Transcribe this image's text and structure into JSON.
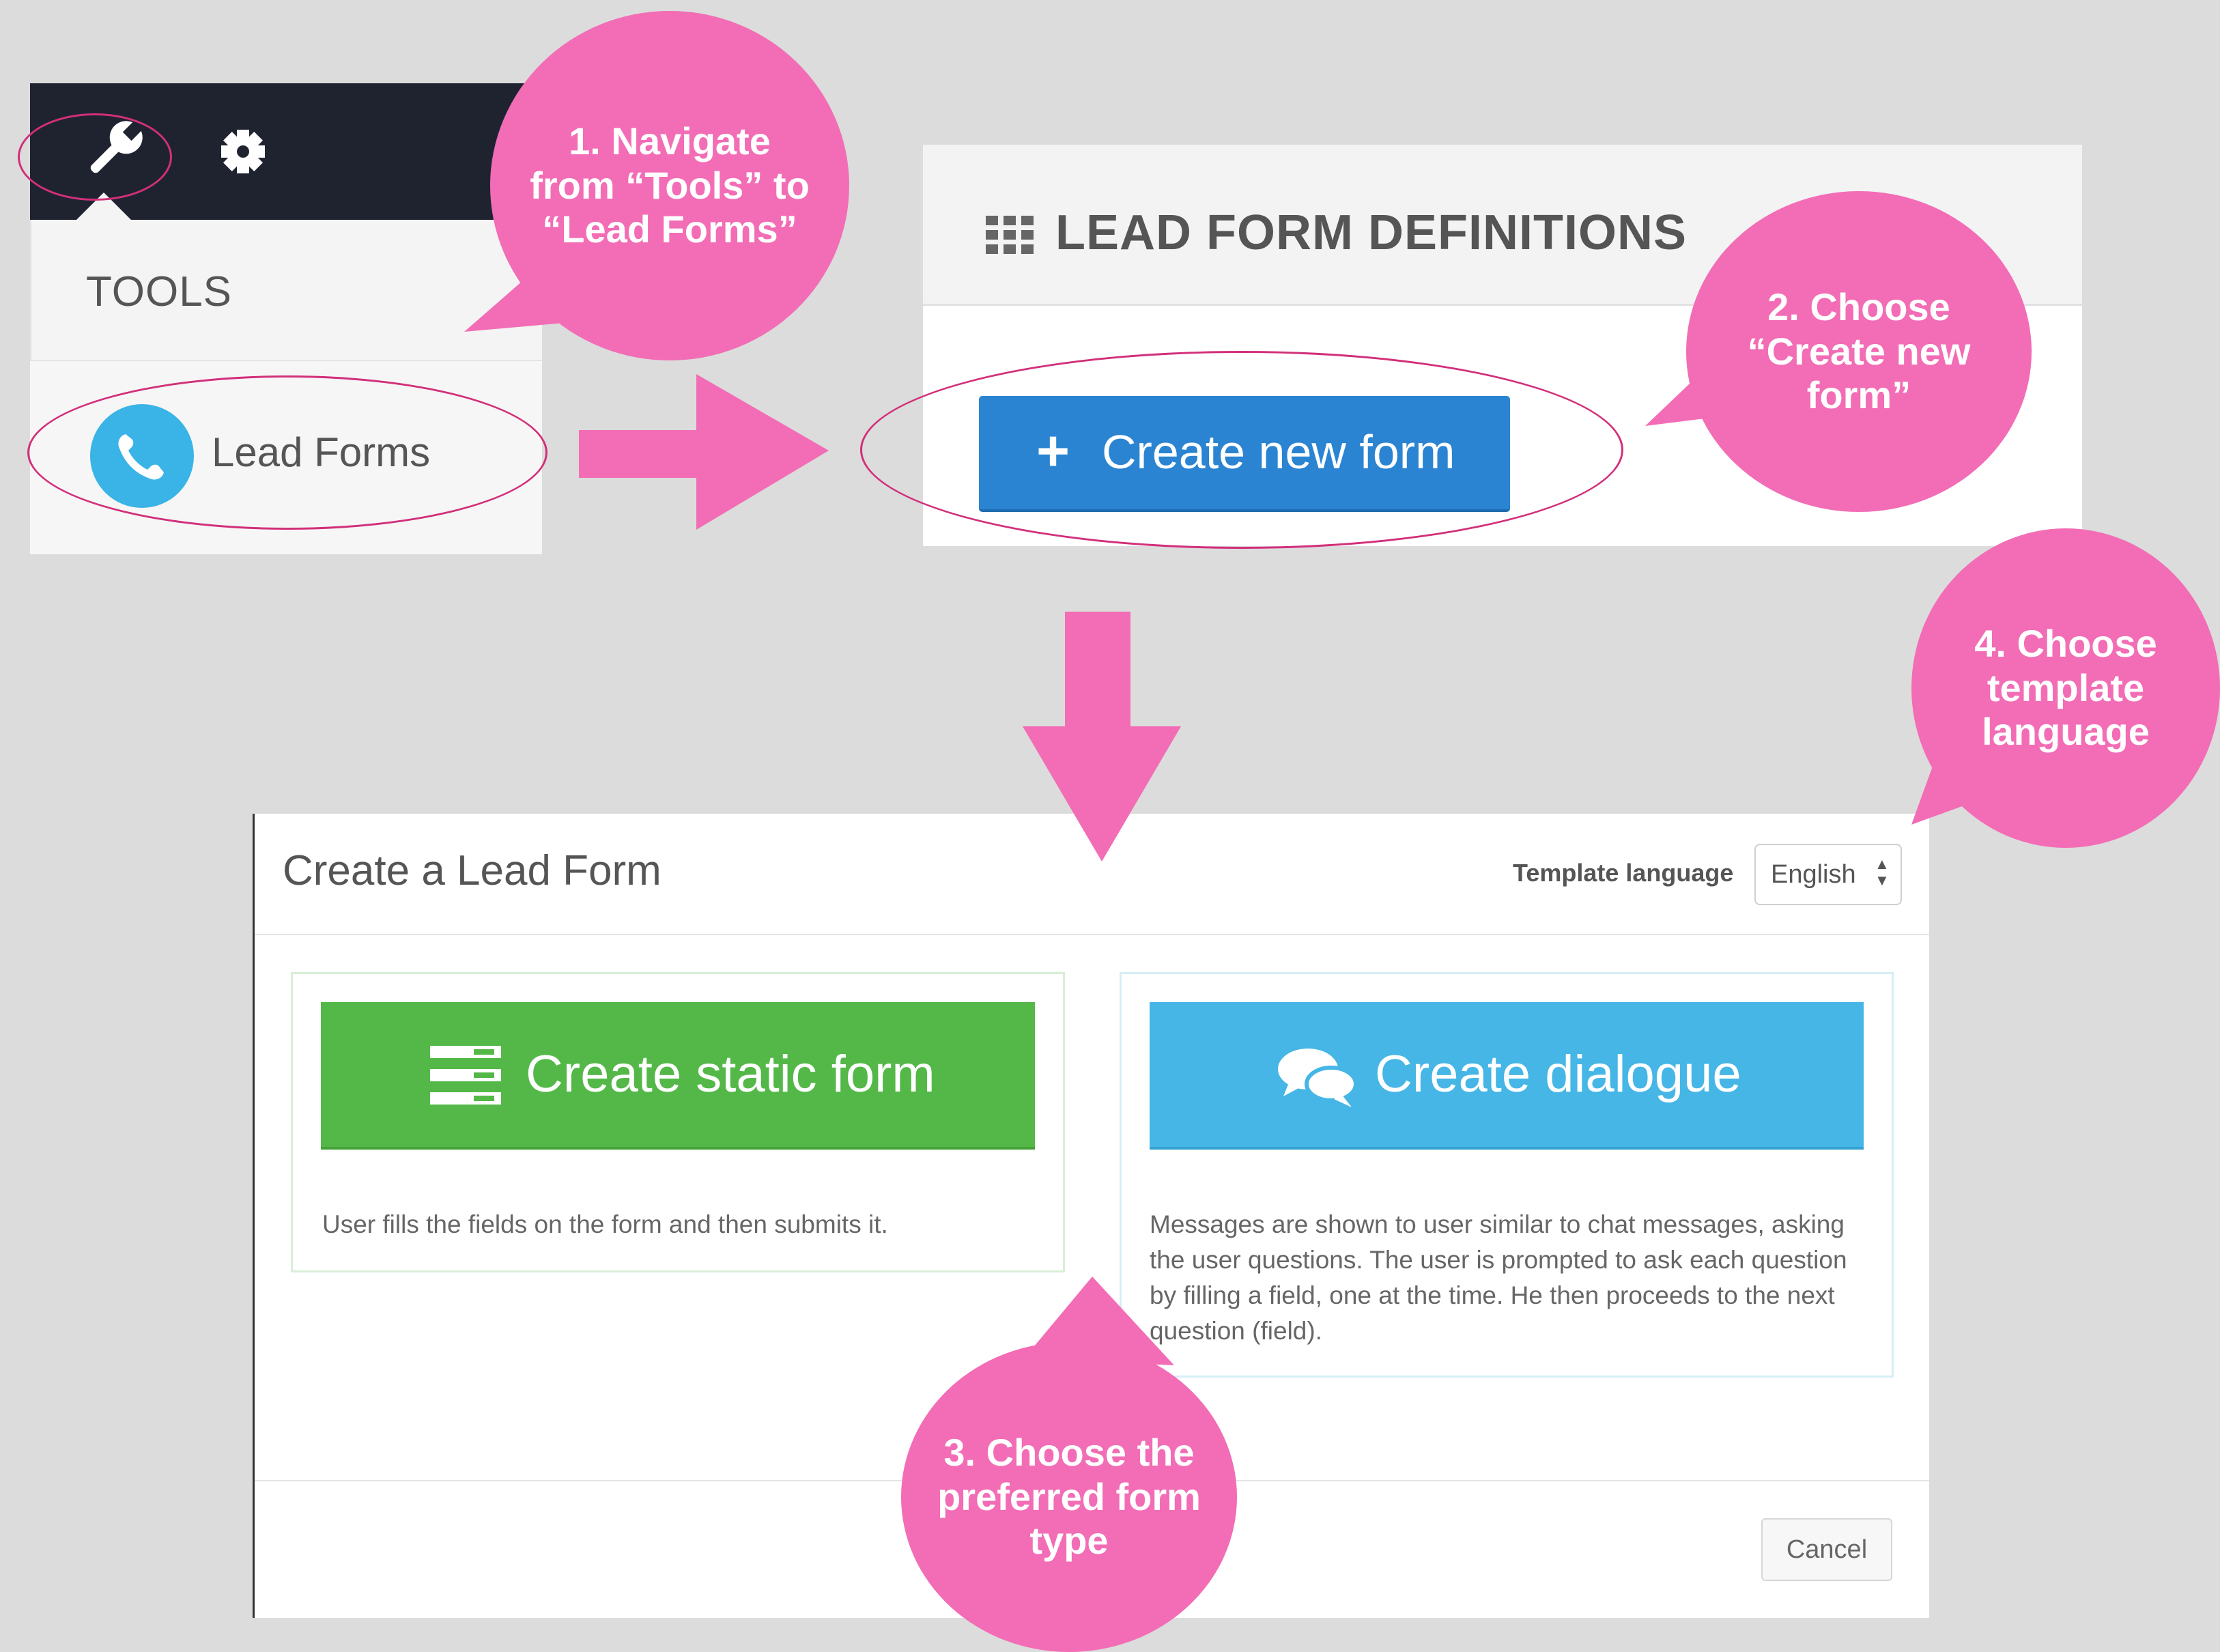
{
  "tools_menu": {
    "section_label": "TOOLS",
    "item_label": "Lead Forms",
    "icons": [
      "wrench-icon",
      "gear-icon",
      "phone-icon"
    ]
  },
  "lead_form_definitions": {
    "title": "LEAD FORM DEFINITIONS",
    "create_button": {
      "plus": "+",
      "label": "Create new form"
    }
  },
  "create_modal": {
    "title": "Create a Lead Form",
    "template_language_label": "Template language",
    "template_language_value": "English",
    "static_form": {
      "button_label": "Create static form",
      "description": "User fills the fields on the form and then submits it."
    },
    "dialogue": {
      "button_label": "Create dialogue",
      "description": "Messages are shown to user similar to chat messages, asking the user questions. The user is prompted to ask each question by filling a field, one at the time. He then proceeds to the next question (field)."
    },
    "cancel_label": "Cancel"
  },
  "annotations": {
    "step1": "1. Navigate\nfrom “Tools”  to\n“Lead Forms”",
    "step2": "2. Choose\n“Create new\nform”",
    "step3": "3. Choose the\npreferred form\ntype",
    "step4": "4. Choose\ntemplate\nlanguage"
  },
  "colors": {
    "annotation_pink": "#f26db5",
    "ellipse_magenta": "#d22f7a",
    "primary_blue": "#2a84d2",
    "static_green": "#54b848",
    "dialogue_blue": "#45b6e5",
    "topbar_dark": "#1f2330"
  }
}
